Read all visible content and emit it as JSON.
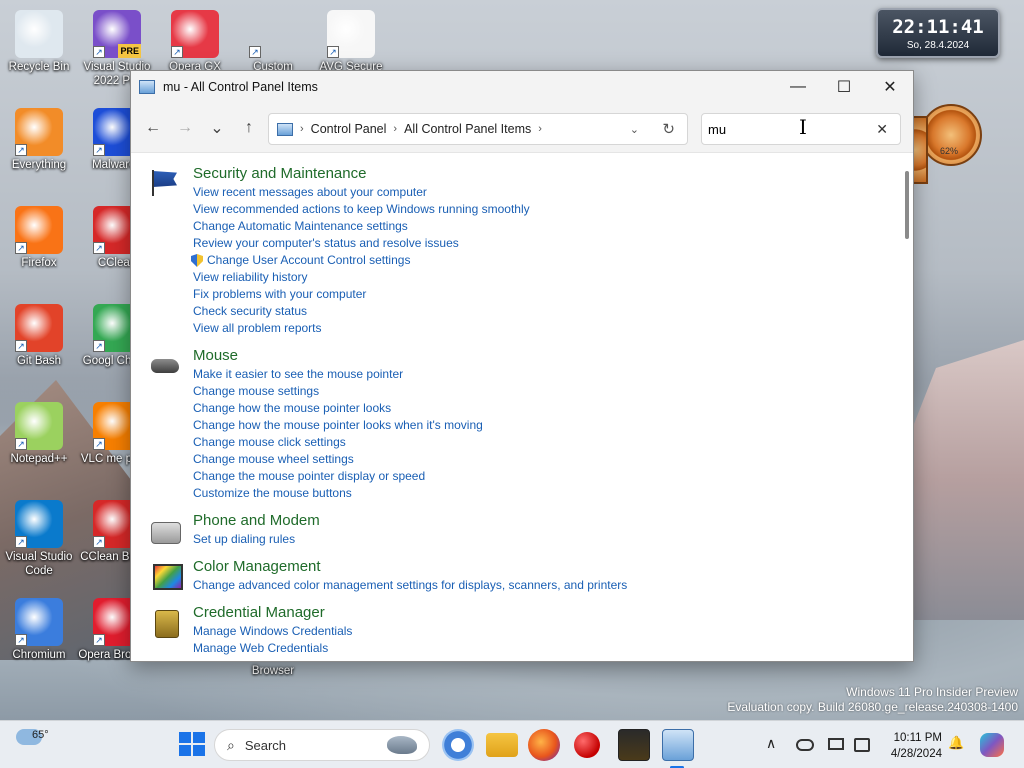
{
  "desktop": {
    "icons": [
      {
        "label": "Recycle Bin",
        "icon": "recycle-bin-icon"
      },
      {
        "label": "Visual Studio 2022 Pre",
        "icon": "visual-studio-icon",
        "badge": "PRE"
      },
      {
        "label": "Opera GX",
        "icon": "opera-gx-icon"
      },
      {
        "label": "Custom",
        "icon": "custom-cursor-icon"
      },
      {
        "label": "AVG Secure",
        "icon": "avg-secure-icon"
      },
      {
        "label": "Everything",
        "icon": "everything-icon"
      },
      {
        "label": "Malwareb",
        "icon": "malwarebytes-icon"
      },
      {
        "label": "Firefox",
        "icon": "firefox-icon"
      },
      {
        "label": "CClean",
        "icon": "ccleaner-icon"
      },
      {
        "label": "Git Bash",
        "icon": "git-bash-icon"
      },
      {
        "label": "Googl Chrom",
        "icon": "chrome-icon"
      },
      {
        "label": "Notepad++",
        "icon": "notepad-plus-icon"
      },
      {
        "label": "VLC me playe",
        "icon": "vlc-icon"
      },
      {
        "label": "Visual Studio Code",
        "icon": "vscode-icon"
      },
      {
        "label": "CClean Brows",
        "icon": "ccleaner-browser-icon"
      },
      {
        "label": "Chromium",
        "icon": "chromium-icon"
      },
      {
        "label": "Opera Browser",
        "icon": "opera-icon"
      },
      {
        "label": "Browser",
        "icon": "browser-icon"
      }
    ],
    "clock_widget": {
      "time": "22:11:41",
      "date": "So, 28.4.2024"
    },
    "gauge_label": "62%",
    "watermark": {
      "line1": "Windows 11 Pro Insider Preview",
      "line2": "Evaluation copy. Build 26080.ge_release.240308-1400"
    }
  },
  "window": {
    "title": "mu - All Control Panel Items",
    "controls": {
      "minimize": "—",
      "maximize": "☐",
      "close": "✕"
    },
    "nav": {
      "back": "←",
      "forward": "→",
      "recent": "⌄",
      "up": "↑"
    },
    "breadcrumb": [
      "Control Panel",
      "All Control Panel Items"
    ],
    "crumb_sep": "›",
    "address_dropdown": "⌄",
    "refresh": "↻",
    "search": {
      "value": "mu",
      "clear": "✕"
    },
    "groups": [
      {
        "title": "Security and Maintenance",
        "icon": "security-flag-icon",
        "links": [
          "View recent messages about your computer",
          "View recommended actions to keep Windows running smoothly",
          "Change Automatic Maintenance settings",
          "Review your computer's status and resolve issues",
          "Change User Account Control settings",
          "View reliability history",
          "Fix problems with your computer",
          "Check security status",
          "View all problem reports"
        ]
      },
      {
        "title": "Mouse",
        "icon": "mouse-icon",
        "links": [
          "Make it easier to see the mouse pointer",
          "Change mouse settings",
          "Change how the mouse pointer looks",
          "Change how the mouse pointer looks when it's moving",
          "Change mouse click settings",
          "Change mouse wheel settings",
          "Change the mouse pointer display or speed",
          "Customize the mouse buttons"
        ]
      },
      {
        "title": "Phone and Modem",
        "icon": "phone-modem-icon",
        "links": [
          "Set up dialing rules"
        ]
      },
      {
        "title": "Color Management",
        "icon": "color-management-icon",
        "links": [
          "Change advanced color management settings for displays, scanners, and printers"
        ]
      },
      {
        "title": "Credential Manager",
        "icon": "credential-manager-icon",
        "links": [
          "Manage Windows Credentials",
          "Manage Web Credentials"
        ]
      }
    ]
  },
  "taskbar": {
    "weather": "65°",
    "search_placeholder": "Search",
    "search_icon": "⌕",
    "clock": {
      "time": "10:11 PM",
      "date": "4/28/2024"
    },
    "tray": {
      "chevron": "∧",
      "bell": "🔔"
    }
  }
}
